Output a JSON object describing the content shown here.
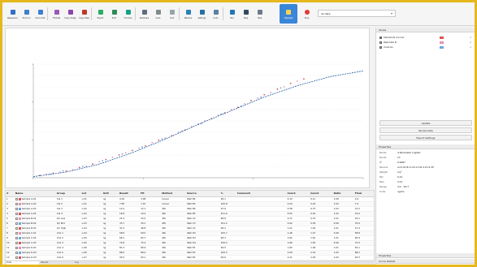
{
  "toolbar": {
    "buttons": [
      {
        "label": "Regression",
        "icon": "regression-icon",
        "color": "#2f6fc4"
      },
      {
        "label": "Zoom In",
        "icon": "zoom-in-icon",
        "color": "#3d7fd0"
      },
      {
        "label": "Zoom Out",
        "icon": "zoom-out-icon",
        "color": "#3d7fd0"
      },
      {
        "label": "Fit Data",
        "icon": "fit-data-icon",
        "color": "#9b59b6"
      },
      {
        "label": "Copy Image",
        "icon": "copy-image-icon",
        "color": "#8e44ad"
      },
      {
        "label": "Copy Data",
        "icon": "copy-data-icon",
        "color": "#c0392b"
      },
      {
        "label": "Export",
        "icon": "export-icon",
        "color": "#27ae60"
      },
      {
        "label": "Print",
        "icon": "print-icon",
        "color": "#2e8b57"
      },
      {
        "label": "Formula",
        "icon": "formula-icon",
        "color": "#16a085"
      },
      {
        "label": "Residuals",
        "icon": "residuals-icon",
        "color": "#5d6d7e"
      },
      {
        "label": "Axes",
        "icon": "axes-icon",
        "color": "#7f8c8d"
      },
      {
        "label": "Grid",
        "icon": "grid-icon",
        "color": "#95a5a6"
      },
      {
        "label": "Markers",
        "icon": "markers-icon",
        "color": "#2980b9"
      },
      {
        "label": "Settings",
        "icon": "settings-icon",
        "color": "#2471a3"
      },
      {
        "label": "Undo",
        "icon": "undo-icon",
        "color": "#5b7fa6"
      },
      {
        "label": "Run",
        "icon": "run-icon",
        "color": "#1f77b4"
      },
      {
        "label": "Step",
        "icon": "step-icon",
        "color": "#34495e"
      },
      {
        "label": "Help",
        "icon": "help-icon",
        "color": "#6c7a89"
      }
    ],
    "active_button": {
      "label": "Highlight",
      "icon": "highlight-icon",
      "color": "#ffd54f"
    },
    "stop_button": {
      "label": "Stop",
      "icon": "stop-icon",
      "color": "#e53935"
    },
    "dropdown_value": "All data"
  },
  "chart_data": {
    "type": "scatter",
    "title": "",
    "xlabel": "",
    "ylabel": "",
    "xlim": [
      0,
      100
    ],
    "ylim": [
      0,
      100
    ],
    "x_ticks": [
      "",
      "",
      "",
      ""
    ],
    "y_ticks": [
      "",
      "",
      "",
      ""
    ],
    "grid": true,
    "series": [
      {
        "kind": "points",
        "color": "#d9534f",
        "points": [
          [
            2,
            2
          ],
          [
            6,
            4
          ],
          [
            10,
            6
          ],
          [
            14,
            9
          ],
          [
            18,
            12
          ],
          [
            22,
            16
          ],
          [
            26,
            20
          ],
          [
            30,
            24
          ],
          [
            34,
            28
          ],
          [
            38,
            33
          ],
          [
            42,
            37
          ],
          [
            46,
            42
          ],
          [
            50,
            47
          ],
          [
            54,
            52
          ],
          [
            58,
            57
          ],
          [
            62,
            62
          ],
          [
            66,
            68
          ],
          [
            70,
            73
          ],
          [
            74,
            78
          ],
          [
            78,
            83
          ],
          [
            82,
            87
          ]
        ]
      },
      {
        "kind": "points",
        "color": "#e88fb0",
        "points": [
          [
            4,
            3
          ],
          [
            8,
            5
          ],
          [
            12,
            7
          ],
          [
            16,
            10
          ],
          [
            20,
            14
          ],
          [
            24,
            18
          ],
          [
            28,
            22
          ],
          [
            32,
            26
          ],
          [
            36,
            31
          ],
          [
            40,
            35
          ],
          [
            44,
            40
          ],
          [
            48,
            45
          ],
          [
            52,
            50
          ],
          [
            56,
            55
          ],
          [
            60,
            60
          ],
          [
            64,
            65
          ],
          [
            68,
            70
          ],
          [
            72,
            75
          ],
          [
            76,
            80
          ],
          [
            80,
            85
          ]
        ]
      },
      {
        "kind": "points",
        "color": "#6aa6e0",
        "points": [
          [
            5,
            3
          ],
          [
            9,
            6
          ],
          [
            15,
            10
          ],
          [
            21,
            15
          ],
          [
            27,
            21
          ],
          [
            33,
            27
          ],
          [
            39,
            34
          ],
          [
            45,
            41
          ],
          [
            51,
            48
          ],
          [
            57,
            56
          ],
          [
            63,
            63
          ],
          [
            69,
            71
          ],
          [
            75,
            79
          ]
        ]
      },
      {
        "kind": "curve",
        "color": "#1f5fa8",
        "points": [
          [
            0,
            1
          ],
          [
            10,
            5
          ],
          [
            20,
            12
          ],
          [
            30,
            22
          ],
          [
            40,
            34
          ],
          [
            50,
            47
          ],
          [
            60,
            59
          ],
          [
            70,
            71
          ],
          [
            80,
            81
          ],
          [
            90,
            89
          ],
          [
            100,
            94
          ]
        ]
      }
    ]
  },
  "table": {
    "headers": [
      "#",
      "Name",
      "Group",
      "Lot",
      "Unit",
      "Result",
      "Fit",
      "Method",
      "Source",
      "%",
      "Comment",
      "Conc1",
      "Conc2",
      "Ratio",
      "Final"
    ],
    "rows": [
      {
        "id": "1",
        "name": "Sample A-01",
        "group": "Cal 1",
        "lot": "L-01",
        "unit": "ng",
        "result": "4.02",
        "fit": "3.98",
        "method": "Linear",
        "source": "Well B2",
        "pct": "99.1",
        "comment": "",
        "c1": "0.12",
        "c2": "0.11",
        "ratio": "1.09",
        "final": "4.0",
        "color": "#d9534f"
      },
      {
        "id": "2",
        "name": "Sample A-02",
        "group": "Cal 2",
        "lot": "L-01",
        "unit": "ng",
        "result": "7.85",
        "fit": "7.91",
        "method": "Linear",
        "source": "Well B3",
        "pct": "100.8",
        "comment": "",
        "c1": "0.24",
        "c2": "0.23",
        "ratio": "1.04",
        "final": "7.9",
        "color": "#e88fb0"
      },
      {
        "id": "3",
        "name": "Sample A-03",
        "group": "Cal 3",
        "lot": "L-02",
        "unit": "ng",
        "result": "12.4",
        "fit": "12.1",
        "method": "4PL",
        "source": "Well B4",
        "pct": "97.6",
        "comment": "",
        "c1": "0.38",
        "c2": "0.37",
        "ratio": "1.03",
        "final": "12.2",
        "color": "#6aa6e0"
      },
      {
        "id": "4",
        "name": "Sample A-04",
        "group": "Cal 4",
        "lot": "L-02",
        "unit": "ng",
        "result": "18.9",
        "fit": "19.2",
        "method": "4PL",
        "source": "Well B5",
        "pct": "101.6",
        "comment": "",
        "c1": "0.55",
        "c2": "0.54",
        "ratio": "1.02",
        "final": "19.0",
        "color": "#d9534f"
      },
      {
        "id": "5",
        "name": "Sample B-01",
        "group": "QC Low",
        "lot": "L-03",
        "unit": "ng",
        "result": "25.3",
        "fit": "25.0",
        "method": "4PL",
        "source": "Well C2",
        "pct": "98.8",
        "comment": "",
        "c1": "0.71",
        "c2": "0.70",
        "ratio": "1.01",
        "final": "25.1",
        "color": "#e88fb0"
      },
      {
        "id": "6",
        "name": "Sample B-02",
        "group": "QC Mid",
        "lot": "L-03",
        "unit": "ng",
        "result": "33.7",
        "fit": "34.1",
        "method": "4PL",
        "source": "Well C3",
        "pct": "101.2",
        "comment": "",
        "c1": "0.92",
        "c2": "0.93",
        "ratio": "0.99",
        "final": "33.9",
        "color": "#6aa6e0"
      },
      {
        "id": "7",
        "name": "Sample B-03",
        "group": "QC High",
        "lot": "L-04",
        "unit": "ng",
        "result": "47.2",
        "fit": "46.8",
        "method": "4PL",
        "source": "Well C4",
        "pct": "99.2",
        "comment": "",
        "c1": "1.21",
        "c2": "1.20",
        "ratio": "1.01",
        "final": "47.0",
        "color": "#d9534f"
      },
      {
        "id": "8",
        "name": "Sample C-01",
        "group": "Unk 1",
        "lot": "L-04",
        "unit": "ng",
        "result": "58.6",
        "fit": "59.0",
        "method": "4PL",
        "source": "Well D2",
        "pct": "100.7",
        "comment": "",
        "c1": "1.46",
        "c2": "1.47",
        "ratio": "0.99",
        "final": "58.8",
        "color": "#e88fb0"
      },
      {
        "id": "9",
        "name": "Sample C-02",
        "group": "Unk 2",
        "lot": "L-05",
        "unit": "ng",
        "result": "66.1",
        "fit": "65.7",
        "method": "4PL",
        "source": "Well D3",
        "pct": "99.4",
        "comment": "",
        "c1": "1.62",
        "c2": "1.61",
        "ratio": "1.01",
        "final": "65.9",
        "color": "#6aa6e0"
      },
      {
        "id": "10",
        "name": "Sample C-03",
        "group": "Unk 3",
        "lot": "L-05",
        "unit": "ng",
        "result": "74.8",
        "fit": "75.2",
        "method": "4PL",
        "source": "Well D4",
        "pct": "100.5",
        "comment": "",
        "c1": "1.80",
        "c2": "1.81",
        "ratio": "0.99",
        "final": "75.0",
        "color": "#d9534f"
      },
      {
        "id": "11",
        "name": "Sample D-01",
        "group": "Unk 4",
        "lot": "L-06",
        "unit": "ng",
        "result": "81.3",
        "fit": "80.9",
        "method": "4PL",
        "source": "Well E2",
        "pct": "99.5",
        "comment": "",
        "c1": "1.95",
        "c2": "1.94",
        "ratio": "1.01",
        "final": "81.1",
        "color": "#e88fb0"
      },
      {
        "id": "12",
        "name": "Sample D-02",
        "group": "Unk 5",
        "lot": "L-06",
        "unit": "ng",
        "result": "88.0",
        "fit": "88.4",
        "method": "4PL",
        "source": "Well E3",
        "pct": "100.5",
        "comment": "",
        "c1": "2.09",
        "c2": "2.10",
        "ratio": "1.00",
        "final": "88.2",
        "color": "#6aa6e0"
      },
      {
        "id": "13",
        "name": "Sample D-03",
        "group": "Unk 6",
        "lot": "L-07",
        "unit": "ng",
        "result": "93.5",
        "fit": "93.1",
        "method": "4PL",
        "source": "Well E4",
        "pct": "99.6",
        "comment": "",
        "c1": "2.21",
        "c2": "2.20",
        "ratio": "1.00",
        "final": "93.3",
        "color": "#d9534f"
      }
    ]
  },
  "bottom_tabs": [
    "Data",
    "Results",
    "Log"
  ],
  "right_panel": {
    "series_header": "Series",
    "series": [
      {
        "name": "Standards (Curve)",
        "color": "#d9534f",
        "vis": "✓"
      },
      {
        "name": "Replicate B",
        "color": "#e88fb0",
        "vis": "✓"
      },
      {
        "name": "Controls",
        "color": "#6aa6e0",
        "vis": "✓"
      }
    ],
    "buttons": [
      "Update",
      "Recalculate",
      "Export Settings"
    ],
    "props_header": "Properties",
    "props": [
      {
        "k": "Model",
        "v": "4-Parameter Logistic"
      },
      {
        "k": "Points",
        "v": "13"
      },
      {
        "k": "R²",
        "v": "0.9987"
      },
      {
        "k": "Params",
        "v": "A=0.01 B=1.24 C=41.3 D=2.35"
      },
      {
        "k": "Weight",
        "v": "1/y²"
      },
      {
        "k": "Min",
        "v": "0.12"
      },
      {
        "k": "Max",
        "v": "2.21"
      },
      {
        "k": "Range",
        "v": "4.0 – 93.3"
      },
      {
        "k": "Units",
        "v": "ng/mL"
      }
    ],
    "footer": [
      "Properties",
      "Curve Details"
    ]
  }
}
